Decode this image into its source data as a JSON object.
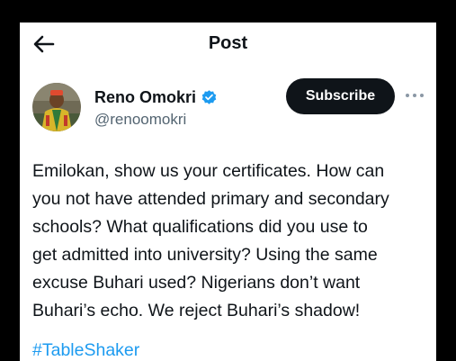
{
  "header": {
    "back_icon": "arrow-left-icon",
    "title": "Post"
  },
  "author": {
    "name": "Reno Omokri",
    "verified_icon": "verified-badge-icon",
    "handle": "@renoomokri"
  },
  "actions": {
    "subscribe_label": "Subscribe",
    "more_icon": "more-horizontal-icon"
  },
  "tweet": {
    "text": "Emilokan, show us your certificates. How can\nyou not have attended primary and secondary\nschools? What qualifications did you use to\nget admitted into university? Using the same\nexcuse Buhari used? Nigerians don’t want\nBuhari’s echo. We reject Buhari’s shadow!",
    "hashtag": "#TableShaker"
  },
  "colors": {
    "background": "#000000",
    "panel": "#ffffff",
    "text": "#0f1419",
    "secondary_text": "#536471",
    "link": "#1d9bf0",
    "verified": "#1d9bf0",
    "button": "#0f1419"
  }
}
